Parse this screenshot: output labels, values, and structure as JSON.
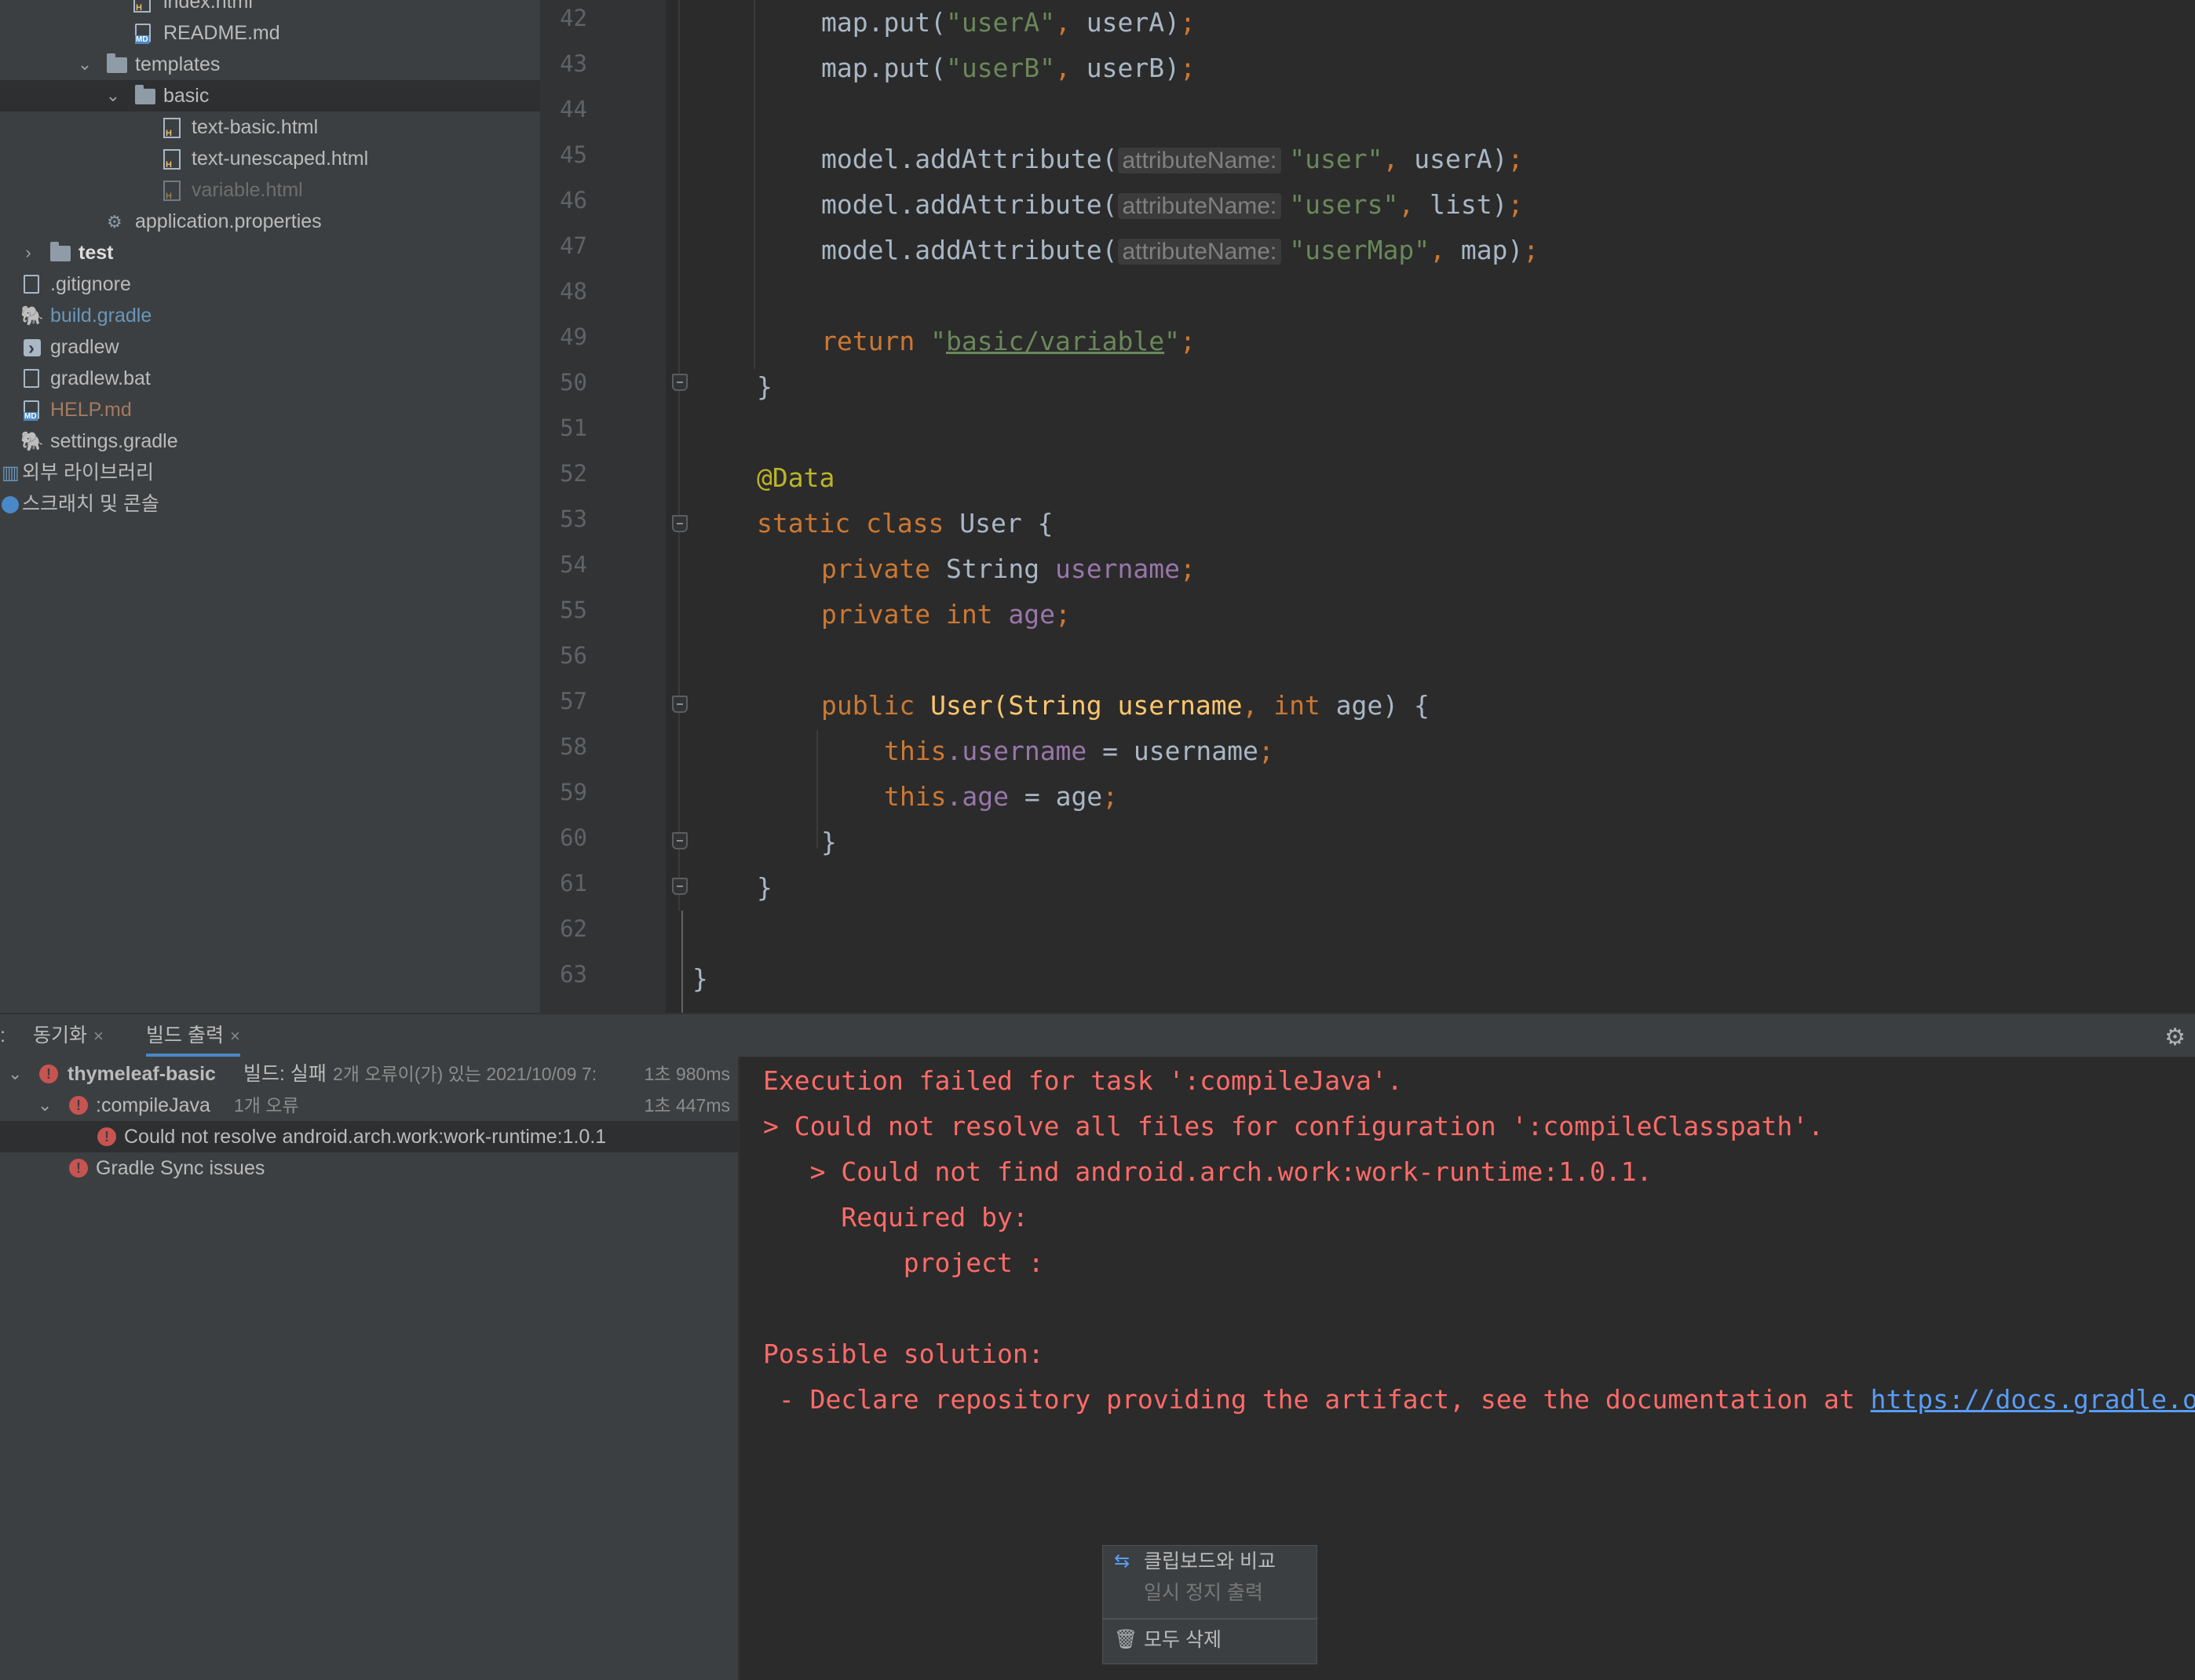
{
  "project_tree": {
    "items": [
      {
        "label": "index.html",
        "color": "#bbbbbb"
      },
      {
        "label": "README.md",
        "color": "#bbbbbb"
      },
      {
        "label": "templates",
        "color": "#bbbbbb"
      },
      {
        "label": "basic",
        "color": "#bbbbbb"
      },
      {
        "label": "text-basic.html",
        "color": "#bbbbbb"
      },
      {
        "label": "text-unescaped.html",
        "color": "#bbbbbb"
      },
      {
        "label": "variable.html",
        "color": "#6e6e6e"
      },
      {
        "label": "application.properties",
        "color": "#bbbbbb"
      },
      {
        "label": "test",
        "color": "#bbbbbb"
      },
      {
        "label": ".gitignore",
        "color": "#bbbbbb"
      },
      {
        "label": "build.gradle",
        "color": "#6897bb"
      },
      {
        "label": "gradlew",
        "color": "#bbbbbb"
      },
      {
        "label": "gradlew.bat",
        "color": "#bbbbbb"
      },
      {
        "label": "HELP.md",
        "color": "#a37b5f"
      },
      {
        "label": "settings.gradle",
        "color": "#bbbbbb"
      },
      {
        "label": "외부 라이브러리",
        "color": "#bbbbbb"
      },
      {
        "label": "스크래치 및 콘솔",
        "color": "#bbbbbb"
      }
    ]
  },
  "editor": {
    "line_numbers": [
      "42",
      "43",
      "44",
      "45",
      "46",
      "47",
      "48",
      "49",
      "50",
      "51",
      "52",
      "53",
      "54",
      "55",
      "56",
      "57",
      "58",
      "59",
      "60",
      "61",
      "62",
      "63"
    ],
    "hint_label": "attributeName:",
    "tokens": {
      "map_put": "map.put(",
      "userA_str": "\"userA\"",
      "userB_str": "\"userB\"",
      "userA_arg": " userA)",
      "userB_arg": " userB)",
      "model_add": "model.addAttribute(",
      "user_str": "\"user\"",
      "users_str": "\"users\"",
      "usermap_str": "\"userMap\"",
      "list_arg": " list)",
      "map_arg": " map)",
      "return_kw": "return",
      "return_str_open": "\"",
      "return_path": "basic/variable",
      "return_str_close": "\"",
      "semicolon": ";",
      "comma": ",",
      "close_brace": "}",
      "annotation": "@Data",
      "static_kw": "static class",
      "user_class": " User {",
      "private_kw": "private",
      "string_type": " String",
      "username_field": " username",
      "int_kw": " int",
      "age_field": " age",
      "public_kw": "public",
      "ctor_name": " User(String username",
      "ctor_rest": " age) {",
      "this_kw": "this",
      "dot_username": ".username",
      "assign_username": " = username",
      "dot_age": ".age",
      "assign_age": " = age"
    }
  },
  "build_panel": {
    "tabs": [
      {
        "label": "동기화",
        "active": false
      },
      {
        "label": "빌드 출력",
        "active": true
      }
    ],
    "tab_prefix": ":",
    "close_glyph": "×",
    "tree": {
      "root_name": "thymeleaf-basic",
      "root_status": "빌드: 실패",
      "root_detail": "2개 오류이(가) 있는 2021/10/09 7:",
      "root_time": "1초 980ms",
      "task_name": ":compileJava",
      "task_detail": "1개 오류",
      "task_time": "1초 447ms",
      "error_item": "Could not resolve android.arch.work:work-runtime:1.0.1",
      "sync_item": "Gradle Sync issues"
    },
    "console_lines": [
      "Execution failed for task ':compileJava'.",
      "> Could not resolve all files for configuration ':compileClasspath'.",
      "   > Could not find android.arch.work:work-runtime:1.0.1.",
      "     Required by:",
      "         project :",
      "",
      "Possible solution:",
      " - Declare repository providing the artifact, see the documentation at "
    ],
    "console_link": "https://docs.gradle.org/current/userguide/declaring_repositories.html"
  },
  "context_menu": {
    "items": [
      {
        "label": "클립보드와 비교",
        "enabled": true,
        "icon": "compare-icon"
      },
      {
        "label": "일시 정지 출력",
        "enabled": false
      },
      {
        "label": "모두 삭제",
        "enabled": true,
        "icon": "trash-icon"
      }
    ]
  }
}
